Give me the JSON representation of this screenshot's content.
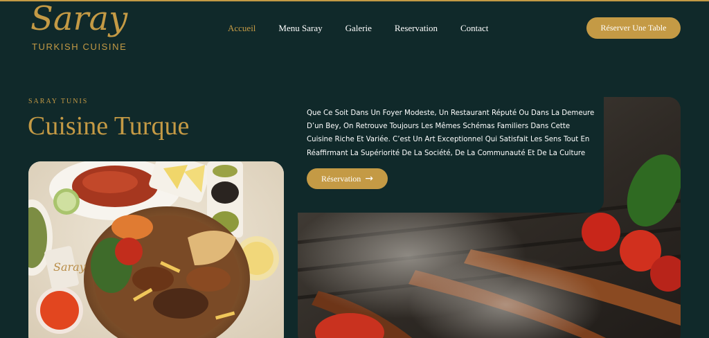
{
  "header": {
    "logo_script": "Saray",
    "logo_subtitle": "TURKISH CUISINE",
    "nav": [
      {
        "label": "Accueil",
        "active": true
      },
      {
        "label": "Menu Saray",
        "active": false
      },
      {
        "label": "Galerie",
        "active": false
      },
      {
        "label": "Reservation",
        "active": false
      },
      {
        "label": "Contact",
        "active": false
      }
    ],
    "cta_label": "Réserver Une Table"
  },
  "hero": {
    "eyebrow": "SARAY TUNIS",
    "title": "Cuisine Turque",
    "description": "Que Ce Soit Dans Un Foyer Modeste, Un Restaurant Réputé Ou Dans La Demeure D’un Bey, On Retrouve Toujours Les Mêmes Schémas Familiers Dans Cette Cuisine Riche Et Variée. C’est Un Art Exceptionnel Qui Satisfait Les Sens Tout En Réaffirmant La Supériorité De La Société, De La Communauté Et De La Culture",
    "button_label": "Réservation",
    "button_icon": "arrow-right-icon",
    "left_image_logo_text": "Saray"
  },
  "colors": {
    "background": "#10292a",
    "accent": "#c49a45",
    "text": "#ffffff"
  }
}
